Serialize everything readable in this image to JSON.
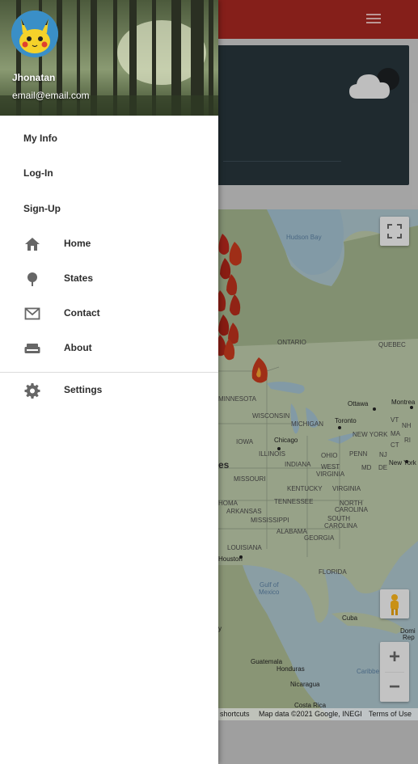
{
  "appbar": {
    "menu_icon": "menu-icon",
    "color": "#a32620"
  },
  "weather": {
    "icon": "cloud-moon-icon"
  },
  "map": {
    "labels": {
      "hudson_bay": "Hudson Bay",
      "ontario": "ONTARIO",
      "quebec": "QUEBEC",
      "minnesota": "MINNESOTA",
      "ottawa": "Ottawa",
      "montreal": "Montrea",
      "wisconsin": "WISCONSIN",
      "michigan": "MICHIGAN",
      "toronto": "Toronto",
      "vt": "VT",
      "nh": "NH",
      "ma": "MA",
      "ct": "CT",
      "ri": "RI",
      "iowa": "IOWA",
      "chicago": "Chicago",
      "new_york_state": "NEW YORK",
      "illinois": "ILLINOIS",
      "indiana": "INDIANA",
      "ohio": "OHIO",
      "penn": "PENN",
      "nj": "NJ",
      "new_york_city": "New York",
      "md": "MD",
      "de": "DE",
      "west_virginia": "WEST",
      "virginia_w": "VIRGINIA",
      "es": "es",
      "missouri": "MISSOURI",
      "kentucky": "KENTUCKY",
      "virginia": "VIRGINIA",
      "tennessee": "TENNESSEE",
      "north_carolina": "NORTH",
      "carolina": "CAROLINA",
      "homa": "HOMA",
      "arkansas": "ARKANSAS",
      "south": "SOUTH",
      "carolina_s": "CAROLINA",
      "mississippi": "MISSISSIPPI",
      "alabama": "ALABAMA",
      "georgia": "GEORGIA",
      "louisiana": "LOUISIANA",
      "houston": "Houston",
      "florida": "FLORIDA",
      "gulf_of": "Gulf of",
      "mexico": "Mexico",
      "cuba": "Cuba",
      "domi": "Domi",
      "rep": "Rep",
      "guatemala": "Guatemala",
      "honduras": "Honduras",
      "caribbean": "Caribbe",
      "nicaragua": "Nicaragua",
      "costa_rica": "Costa Rica",
      "y": "y"
    },
    "fire_icon": "fire-icon",
    "fullscreen_icon": "fullscreen-icon",
    "pegman_icon": "pegman-icon",
    "zoom_in_label": "+",
    "zoom_out_label": "−",
    "footer": {
      "shortcuts": "shortcuts",
      "map_data": "Map data ©2021 Google, INEGI",
      "terms": "Terms of Use"
    }
  },
  "drawer": {
    "header": {
      "avatar_icon": "pikachu-avatar",
      "name": "Jhonatan",
      "email": "email@email.com"
    },
    "items": [
      {
        "label": "My Info",
        "icon": ""
      },
      {
        "label": "Log-In",
        "icon": ""
      },
      {
        "label": "Sign-Up",
        "icon": ""
      },
      {
        "label": "Home",
        "icon": "home-icon"
      },
      {
        "label": "States",
        "icon": "tree-icon"
      },
      {
        "label": "Contact",
        "icon": "mail-icon"
      },
      {
        "label": "About",
        "icon": "couch-icon"
      },
      {
        "label": "Settings",
        "icon": "gear-icon"
      }
    ]
  }
}
